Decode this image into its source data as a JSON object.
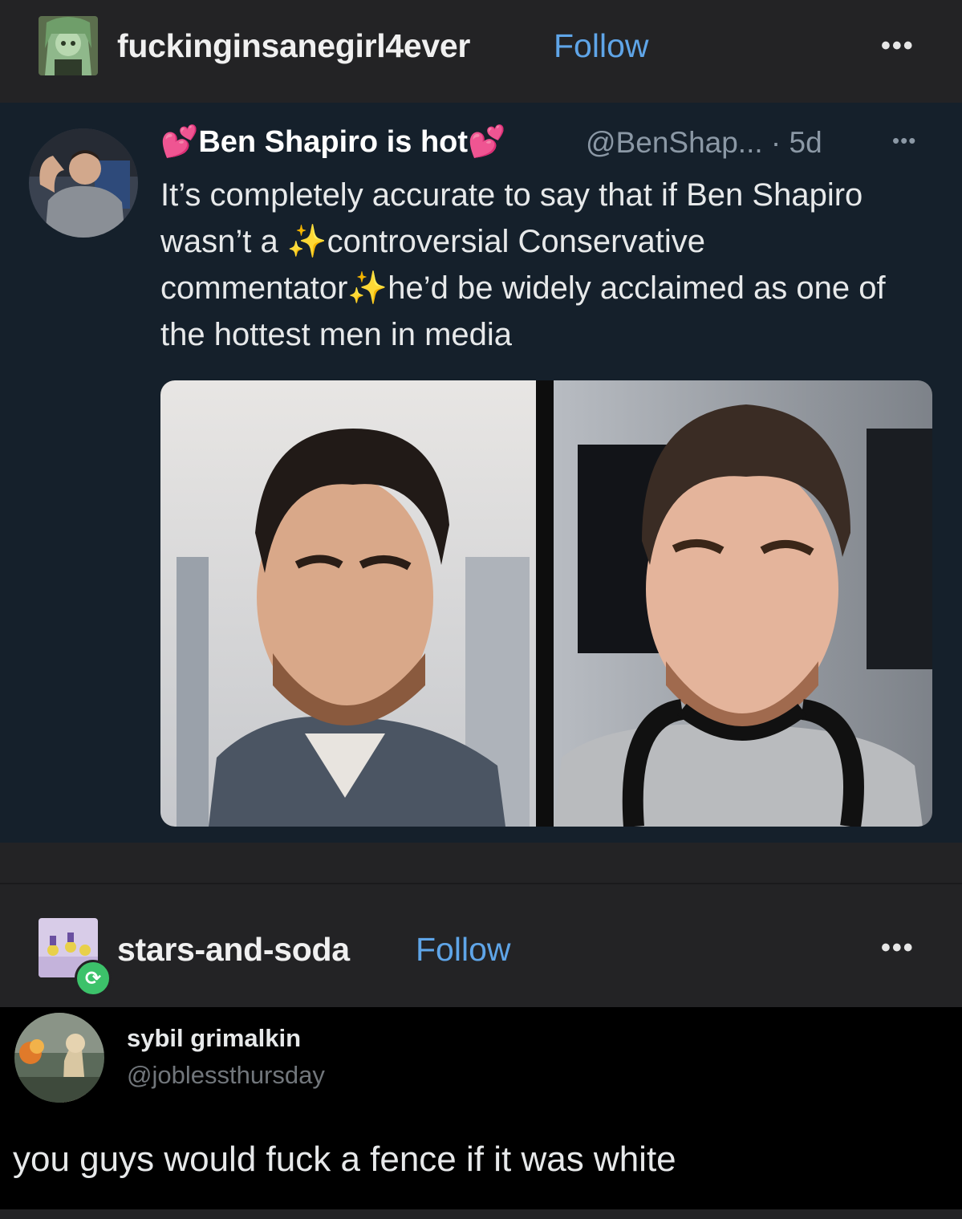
{
  "post1": {
    "username": "fuckinginsanegirl4ever",
    "follow_label": "Follow",
    "more": "•••"
  },
  "tweet": {
    "display_name": "Ben Shapiro is hot",
    "heart_icon": "💕",
    "handle_time": "@BenShap... · 5d",
    "more": "•••",
    "text_part1": "It’s completely accurate to say that if Ben Shapiro wasn’t a ",
    "sparkle": "✨",
    "text_part2": "controversial Conservative commentator",
    "text_part3": "he’d be widely acclaimed as one of the hottest men in media"
  },
  "post2": {
    "username": "stars-and-soda",
    "follow_label": "Follow",
    "more": "•••",
    "reblog_icon": "⟳"
  },
  "reply": {
    "display_name": "sybil grimalkin",
    "handle": "@joblessthursday",
    "text": "you guys would fuck a fence if it was white"
  },
  "colors": {
    "follow": "#5fa5e8",
    "tweet_bg": "#15202b",
    "reblog_green": "#3cc26a"
  }
}
